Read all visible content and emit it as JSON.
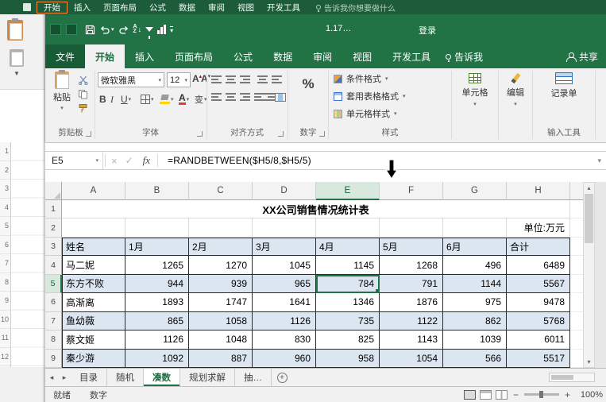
{
  "background": {
    "active_tab": "开始",
    "tabs": [
      "开始",
      "插入",
      "页面布局",
      "公式",
      "数据",
      "审阅",
      "视图",
      "开发工具"
    ],
    "tell_me": "告诉我你想要做什么",
    "row_numbers_last": 12
  },
  "title_bar": {
    "filename": "1.17…",
    "sign_in": "登录"
  },
  "ribbon": {
    "file_tab": "文件",
    "tabs": [
      {
        "label": "开始",
        "active": true
      },
      {
        "label": "插入"
      },
      {
        "label": "页面布局"
      },
      {
        "label": "公式"
      },
      {
        "label": "数据"
      },
      {
        "label": "审阅"
      },
      {
        "label": "视图"
      },
      {
        "label": "开发工具"
      }
    ],
    "tell_me": "告诉我",
    "share": "共享",
    "groups": {
      "clipboard": {
        "label": "剪贴板",
        "paste": "粘贴"
      },
      "font": {
        "label": "字体",
        "font_name": "微软雅黑",
        "font_size": "12",
        "bold": "B",
        "italic": "I",
        "underline": "U",
        "phonetic": "变"
      },
      "alignment": {
        "label": "对齐方式"
      },
      "number": {
        "label": "数字",
        "percent": "%"
      },
      "styles": {
        "label": "样式",
        "conditional_formatting": "条件格式",
        "format_as_table": "套用表格格式",
        "cell_styles": "单元格样式"
      },
      "cells": {
        "label": "单元格"
      },
      "editing": {
        "label": "编辑"
      },
      "input_tools": {
        "label": "输入工具",
        "record_form": "记录单"
      }
    }
  },
  "formula_bar": {
    "name_box": "E5",
    "fx": "fx",
    "formula": "=RANDBETWEEN($H5/8,$H5/5)"
  },
  "sheet": {
    "columns": [
      "A",
      "B",
      "C",
      "D",
      "E",
      "F",
      "G",
      "H"
    ],
    "selected_cell": "E5",
    "title": "XX公司销售情况统计表",
    "unit_note": "单位:万元",
    "banded_fill": "#dce6f1",
    "table": {
      "headers": [
        "姓名",
        "1月",
        "2月",
        "3月",
        "4月",
        "5月",
        "6月",
        "合计"
      ],
      "rows": [
        [
          "马二妮",
          1265,
          1270,
          1045,
          1145,
          1268,
          496,
          6489
        ],
        [
          "东方不败",
          944,
          939,
          965,
          784,
          791,
          1144,
          5567
        ],
        [
          "高渐离",
          1893,
          1747,
          1641,
          1346,
          1876,
          975,
          9478
        ],
        [
          "鱼幼薇",
          865,
          1058,
          1126,
          735,
          1122,
          862,
          5768
        ],
        [
          "蔡文姬",
          1126,
          1048,
          830,
          825,
          1143,
          1039,
          6011
        ],
        [
          "秦少游",
          1092,
          887,
          960,
          958,
          1054,
          566,
          5517
        ]
      ]
    }
  },
  "sheet_tabs": [
    {
      "label": "目录"
    },
    {
      "label": "随机"
    },
    {
      "label": "凑数",
      "active": true
    },
    {
      "label": "规划求解"
    },
    {
      "label": "抽…"
    }
  ],
  "status_bar": {
    "ready": "就绪",
    "mode": "数字",
    "zoom": "100%"
  },
  "colors": {
    "accent": "#217346",
    "dark_green": "#185c37",
    "banded_row": "#dce6f1"
  }
}
